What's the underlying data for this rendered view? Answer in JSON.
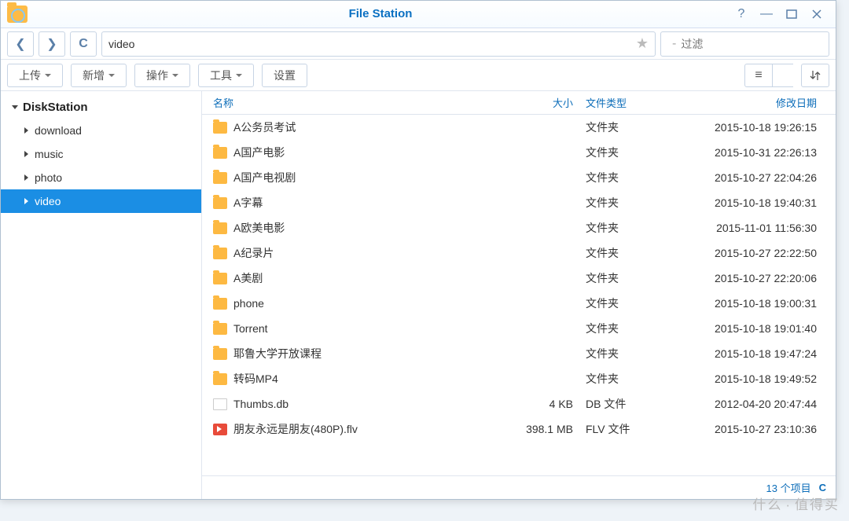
{
  "app": {
    "title": "File Station"
  },
  "window": {
    "help_icon": "help-icon",
    "minimize_icon": "minimize-icon",
    "maximize_icon": "maximize-icon",
    "close_icon": "close-icon"
  },
  "nav": {
    "back_icon": "chevron-left-icon",
    "forward_icon": "chevron-right-icon",
    "refresh_icon": "refresh-icon",
    "path": "video",
    "star_icon": "star-icon"
  },
  "filter": {
    "icon": "search-icon",
    "placeholder": "过滤"
  },
  "toolbar": {
    "upload_label": "上传",
    "create_label": "新增",
    "action_label": "操作",
    "tool_label": "工具",
    "settings_label": "设置",
    "list_icon": "list-view-icon",
    "dropdown_icon": "caret-down-icon",
    "sort_icon": "sort-icon"
  },
  "sidebar": {
    "root": "DiskStation",
    "items": [
      {
        "label": "download",
        "active": false
      },
      {
        "label": "music",
        "active": false
      },
      {
        "label": "photo",
        "active": false
      },
      {
        "label": "video",
        "active": true
      }
    ]
  },
  "columns": {
    "name": "名称",
    "size": "大小",
    "type": "文件类型",
    "date": "修改日期"
  },
  "rows": [
    {
      "icon": "folder",
      "name": "A公务员考试",
      "size": "",
      "type": "文件夹",
      "date": "2015-10-18 19:26:15"
    },
    {
      "icon": "folder",
      "name": "A国产电影",
      "size": "",
      "type": "文件夹",
      "date": "2015-10-31 22:26:13"
    },
    {
      "icon": "folder",
      "name": "A国产电视剧",
      "size": "",
      "type": "文件夹",
      "date": "2015-10-27 22:04:26"
    },
    {
      "icon": "folder",
      "name": "A字幕",
      "size": "",
      "type": "文件夹",
      "date": "2015-10-18 19:40:31"
    },
    {
      "icon": "folder",
      "name": "A欧美电影",
      "size": "",
      "type": "文件夹",
      "date": "2015-11-01 11:56:30"
    },
    {
      "icon": "folder",
      "name": "A纪录片",
      "size": "",
      "type": "文件夹",
      "date": "2015-10-27 22:22:50"
    },
    {
      "icon": "folder",
      "name": "A美剧",
      "size": "",
      "type": "文件夹",
      "date": "2015-10-27 22:20:06"
    },
    {
      "icon": "folder",
      "name": "phone",
      "size": "",
      "type": "文件夹",
      "date": "2015-10-18 19:00:31"
    },
    {
      "icon": "folder",
      "name": "Torrent",
      "size": "",
      "type": "文件夹",
      "date": "2015-10-18 19:01:40"
    },
    {
      "icon": "folder",
      "name": "耶鲁大学开放课程",
      "size": "",
      "type": "文件夹",
      "date": "2015-10-18 19:47:24"
    },
    {
      "icon": "folder",
      "name": "转码MP4",
      "size": "",
      "type": "文件夹",
      "date": "2015-10-18 19:49:52"
    },
    {
      "icon": "file",
      "name": "Thumbs.db",
      "size": "4 KB",
      "type": "DB 文件",
      "date": "2012-04-20 20:47:44"
    },
    {
      "icon": "flv",
      "name": "朋友永远是朋友(480P).flv",
      "size": "398.1 MB",
      "type": "FLV 文件",
      "date": "2015-10-27 23:10:36"
    }
  ],
  "status": {
    "count": "13 个项目",
    "refresh_icon": "refresh-icon"
  },
  "watermark": {
    "text1": "什么",
    "text2": "值得买"
  }
}
